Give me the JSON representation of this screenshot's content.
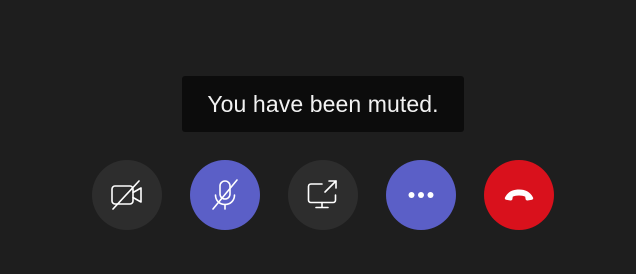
{
  "toast": {
    "message": "You have been muted."
  },
  "controls": [
    {
      "name": "camera-toggle-button",
      "icon": "camera-off-icon",
      "state": "off",
      "color": "#2d2d2d"
    },
    {
      "name": "mic-toggle-button",
      "icon": "mic-off-icon",
      "state": "muted",
      "color": "#5b5fc7"
    },
    {
      "name": "share-screen-button",
      "icon": "share-screen-icon",
      "color": "#2d2d2d"
    },
    {
      "name": "more-options-button",
      "icon": "more-horizontal-icon",
      "color": "#5b5fc7"
    },
    {
      "name": "hang-up-button",
      "icon": "phone-hangup-icon",
      "color": "#d9111c"
    }
  ],
  "colors": {
    "background": "#1e1e1e",
    "toast_background": "#0c0c0c",
    "neutral_button": "#2d2d2d",
    "accent": "#5b5fc7",
    "danger": "#d9111c",
    "icon": "#ffffff"
  }
}
